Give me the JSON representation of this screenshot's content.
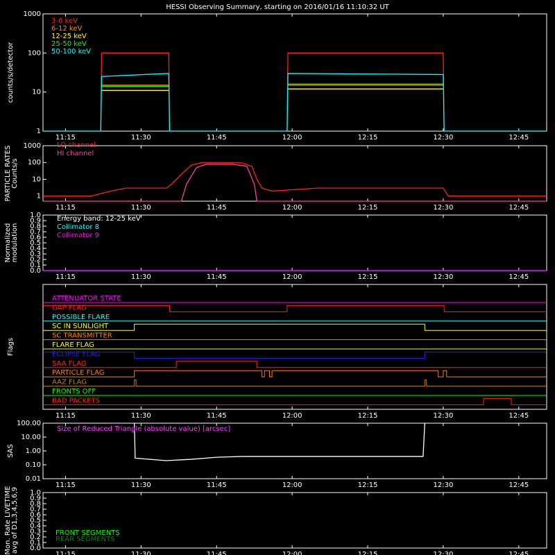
{
  "title": "HESSI Observing Summary, starting on 2016/01/16 11:10:32 UT",
  "time_ticks": [
    "11:15",
    "11:30",
    "11:45",
    "12:00",
    "12:15",
    "12:30",
    "12:45"
  ],
  "chart_data": [
    {
      "type": "line",
      "name": "count-rates",
      "ylabel": "counts/s/detector",
      "yscale": "log",
      "ylim": [
        1,
        1000
      ],
      "ytick_labels": [
        "1",
        "10",
        "100",
        "1000"
      ],
      "xlim": [
        "11:10:32",
        "12:50:32"
      ],
      "series": [
        {
          "name": "3-6 keV",
          "color": "#ff2020",
          "segments": [
            [
              [
                "11:10:32",
                1
              ],
              [
                "11:22:00",
                1
              ],
              [
                "11:22:10",
                100
              ],
              [
                "11:35:30",
                100
              ],
              [
                "11:35:40",
                1
              ],
              [
                "11:59:00",
                1
              ],
              [
                "11:59:10",
                100
              ],
              [
                "12:30:00",
                100
              ],
              [
                "12:30:10",
                1
              ],
              [
                "12:50:32",
                1
              ]
            ]
          ]
        },
        {
          "name": "6-12 keV",
          "color": "#ff9000",
          "segments": [
            [
              [
                "11:22:10",
                15
              ],
              [
                "11:35:30",
                15
              ]
            ],
            [
              [
                "11:59:10",
                15
              ],
              [
                "12:30:00",
                15
              ]
            ]
          ]
        },
        {
          "name": "12-25 keV",
          "color": "#ffff00",
          "segments": [
            [
              [
                "11:22:10",
                11
              ],
              [
                "11:35:30",
                11
              ]
            ],
            [
              [
                "11:59:10",
                12
              ],
              [
                "12:30:00",
                12
              ]
            ]
          ]
        },
        {
          "name": "25-50 keV",
          "color": "#00ff00",
          "segments": [
            [
              [
                "11:22:10",
                14
              ],
              [
                "11:35:30",
                14
              ]
            ],
            [
              [
                "11:59:10",
                16
              ],
              [
                "12:30:00",
                16
              ]
            ]
          ]
        },
        {
          "name": "50-100 keV",
          "color": "#00ffff",
          "segments": [
            [
              [
                "11:10:32",
                1
              ],
              [
                "11:22:00",
                1
              ],
              [
                "11:22:10",
                25
              ],
              [
                "11:35:30",
                30
              ],
              [
                "11:35:40",
                1
              ],
              [
                "11:59:00",
                1
              ],
              [
                "11:59:10",
                30
              ],
              [
                "12:30:00",
                28
              ],
              [
                "12:30:10",
                1
              ],
              [
                "12:50:32",
                1
              ]
            ]
          ]
        }
      ]
    },
    {
      "type": "line",
      "name": "particle-rates",
      "ylabel": [
        "PARTICLE RATES",
        "Counts/s"
      ],
      "yscale": "log",
      "ylim": [
        0.5,
        1000
      ],
      "ytick_labels": [
        "1",
        "10",
        "100",
        "1000"
      ],
      "series": [
        {
          "name": "LO channel",
          "color": "#ff2020",
          "points": [
            [
              "11:10:32",
              1
            ],
            [
              "11:20:00",
              1
            ],
            [
              "11:24:00",
              2
            ],
            [
              "11:27:00",
              3
            ],
            [
              "11:30:00",
              3
            ],
            [
              "11:35:00",
              3
            ],
            [
              "11:36:00",
              5
            ],
            [
              "11:38:00",
              20
            ],
            [
              "11:40:00",
              70
            ],
            [
              "11:42:00",
              100
            ],
            [
              "11:47:00",
              100
            ],
            [
              "11:50:00",
              95
            ],
            [
              "11:52:00",
              60
            ],
            [
              "11:53:00",
              10
            ],
            [
              "11:54:00",
              3
            ],
            [
              "11:56:00",
              2
            ],
            [
              "12:05:00",
              3
            ],
            [
              "12:15:00",
              3
            ],
            [
              "12:20:00",
              3
            ],
            [
              "12:30:00",
              3
            ],
            [
              "12:31:00",
              1
            ],
            [
              "12:50:32",
              1
            ]
          ]
        },
        {
          "name": "HI channel",
          "color": "#ff40a0",
          "points": [
            [
              "11:10:32",
              0.5
            ],
            [
              "11:38:00",
              0.5
            ],
            [
              "11:39:00",
              5
            ],
            [
              "11:41:00",
              50
            ],
            [
              "11:43:00",
              80
            ],
            [
              "11:48:00",
              80
            ],
            [
              "11:51:00",
              60
            ],
            [
              "11:52:30",
              5
            ],
            [
              "11:53:00",
              0.5
            ],
            [
              "12:50:32",
              0.5
            ]
          ]
        }
      ]
    },
    {
      "type": "line",
      "name": "modulation",
      "ylabel": [
        "Normalized",
        "modulation"
      ],
      "ylim": [
        0,
        1
      ],
      "ytick_labels": [
        "0.0",
        "0.1",
        "0.2",
        "0.3",
        "0.4",
        "0.5",
        "0.6",
        "0.7",
        "0.8",
        "0.9",
        "1.0"
      ],
      "annotations": [
        "Energy band: 12-25 keV"
      ],
      "series": [
        {
          "name": "Collimator 8",
          "color": "#00ffff",
          "points": [
            [
              "11:10:32",
              0
            ],
            [
              "12:50:32",
              0
            ]
          ]
        },
        {
          "name": "Collimator 9",
          "color": "#ff00ff",
          "points": [
            [
              "11:10:32",
              0
            ],
            [
              "12:50:32",
              0
            ]
          ]
        }
      ]
    },
    {
      "type": "line",
      "name": "flags",
      "ylabel": "Flags",
      "series": [
        {
          "name": "ATTENUATOR STATE",
          "color": "#ff00ff",
          "steps": [
            [
              "11:10:32",
              0
            ],
            [
              "12:50:32",
              0
            ]
          ]
        },
        {
          "name": "GAP FLAG",
          "color": "#ff2020",
          "steps": [
            [
              "11:10:32",
              1
            ],
            [
              "11:35:40",
              0
            ],
            [
              "11:59:00",
              1
            ],
            [
              "12:30:10",
              0
            ],
            [
              "12:50:32",
              0
            ]
          ]
        },
        {
          "name": "POSSIBLE FLARE",
          "color": "#00ffff",
          "steps": [
            [
              "11:10:32",
              0
            ],
            [
              "12:50:32",
              0
            ]
          ]
        },
        {
          "name": "SC IN SUNLIGHT",
          "color": "#ffff00",
          "steps": [
            [
              "11:10:32",
              0
            ],
            [
              "11:28:40",
              1
            ],
            [
              "12:26:20",
              0
            ],
            [
              "12:50:32",
              0
            ]
          ]
        },
        {
          "name": "SC TRANSMITTER",
          "color": "#ff8000",
          "steps": [
            [
              "11:10:32",
              0
            ],
            [
              "12:50:32",
              0
            ]
          ]
        },
        {
          "name": "FLARE FLAG",
          "color": "#ffff00",
          "steps": [
            [
              "11:10:32",
              0
            ],
            [
              "12:50:32",
              0
            ]
          ]
        },
        {
          "name": "ECLIPSE FLAG",
          "color": "#2020ff",
          "steps": [
            [
              "11:10:32",
              1
            ],
            [
              "11:28:40",
              0
            ],
            [
              "12:26:20",
              1
            ],
            [
              "12:50:32",
              1
            ]
          ]
        },
        {
          "name": "SAA FLAG",
          "color": "#ff2020",
          "steps": [
            [
              "11:10:32",
              0
            ],
            [
              "11:37:00",
              1
            ],
            [
              "11:53:00",
              0
            ],
            [
              "12:50:32",
              0
            ]
          ]
        },
        {
          "name": "PARTICLE FLAG",
          "color": "#ff8000",
          "steps": [
            [
              "11:10:32",
              0
            ],
            [
              "11:28:40",
              1
            ],
            [
              "11:54:00",
              0
            ],
            [
              "11:54:30",
              1
            ],
            [
              "11:55:30",
              0
            ],
            [
              "11:56:00",
              1
            ],
            [
              "12:29:00",
              0
            ],
            [
              "12:30:00",
              1
            ],
            [
              "12:30:40",
              0
            ],
            [
              "12:50:32",
              0
            ]
          ]
        },
        {
          "name": "AAZ FLAG",
          "color": "#c08000",
          "steps": [
            [
              "11:10:32",
              0
            ],
            [
              "11:28:40",
              1
            ],
            [
              "11:29:00",
              0
            ],
            [
              "12:26:20",
              1
            ],
            [
              "12:26:40",
              0
            ],
            [
              "12:50:32",
              0
            ]
          ]
        },
        {
          "name": "FRONTS OFF",
          "color": "#00ff00",
          "steps": [
            [
              "11:10:32",
              0
            ],
            [
              "12:50:32",
              0
            ]
          ]
        },
        {
          "name": "BAD PACKETS",
          "color": "#ff2020",
          "steps": [
            [
              "11:10:32",
              0
            ],
            [
              "12:38:00",
              1
            ],
            [
              "12:43:30",
              0
            ],
            [
              "12:50:32",
              0
            ]
          ]
        }
      ]
    },
    {
      "type": "line",
      "name": "sas",
      "ylabel": "SAS",
      "yscale": "log",
      "ylim": [
        0.01,
        100
      ],
      "ytick_labels": [
        "0.01",
        "0.10",
        "1.00",
        "10.00",
        "100.00"
      ],
      "annotations": [
        "Size of Reduced Triangle (absolute value) [arcsec]"
      ],
      "series": [
        {
          "name": "SAS",
          "color": "#ffffff",
          "points": [
            [
              "11:28:40",
              100
            ],
            [
              "11:28:50",
              0.3
            ],
            [
              "11:35:00",
              0.2
            ],
            [
              "11:40:00",
              0.25
            ],
            [
              "11:45:00",
              0.35
            ],
            [
              "11:50:00",
              0.4
            ],
            [
              "12:00:00",
              0.4
            ],
            [
              "12:15:00",
              0.4
            ],
            [
              "12:26:00",
              0.4
            ],
            [
              "12:26:20",
              100
            ]
          ]
        }
      ]
    },
    {
      "type": "line",
      "name": "livetime",
      "ylabel": [
        "Mon. Rate LIVETIME",
        "avg of D1,3,4,5,6,9"
      ],
      "ylim": [
        0,
        1
      ],
      "ytick_labels": [
        "0.0",
        "0.1",
        "0.2",
        "0.3",
        "0.4",
        "0.5",
        "0.6",
        "0.7",
        "0.8",
        "0.9",
        "1.0"
      ],
      "series": [
        {
          "name": "FRONT SEGMENTS",
          "color": "#00ff00",
          "points": []
        },
        {
          "name": "REAR SEGMENTS",
          "color": "#008000",
          "points": []
        }
      ]
    }
  ]
}
